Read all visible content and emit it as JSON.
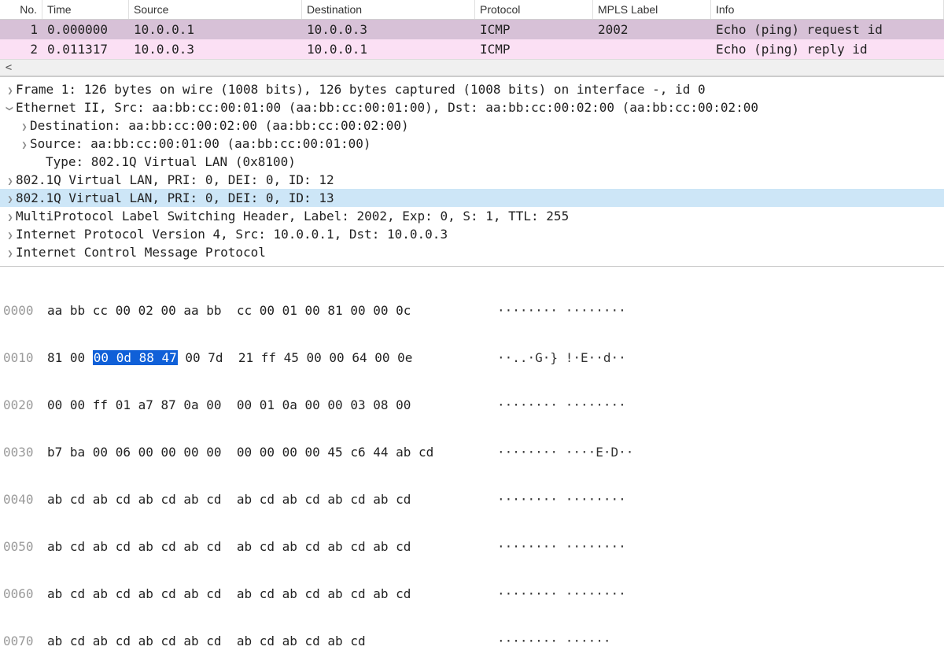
{
  "columns": {
    "no": "No.",
    "time": "Time",
    "source": "Source",
    "destination": "Destination",
    "protocol": "Protocol",
    "mpls": "MPLS Label",
    "info": "Info"
  },
  "packets": [
    {
      "no": "1",
      "time": "0.000000",
      "source": "10.0.0.1",
      "destination": "10.0.0.3",
      "protocol": "ICMP",
      "mpls": "2002",
      "info": "Echo (ping) request  id"
    },
    {
      "no": "2",
      "time": "0.011317",
      "source": "10.0.0.3",
      "destination": "10.0.0.1",
      "protocol": "ICMP",
      "mpls": "",
      "info": "Echo (ping) reply    id"
    }
  ],
  "scroll": {
    "left_arrow": "<"
  },
  "tree": {
    "frame": "Frame 1: 126 bytes on wire (1008 bits), 126 bytes captured (1008 bits) on interface -, id 0",
    "eth": "Ethernet II, Src: aa:bb:cc:00:01:00 (aa:bb:cc:00:01:00), Dst: aa:bb:cc:00:02:00 (aa:bb:cc:00:02:00",
    "eth_dst": "Destination: aa:bb:cc:00:02:00 (aa:bb:cc:00:02:00)",
    "eth_src": "Source: aa:bb:cc:00:01:00 (aa:bb:cc:00:01:00)",
    "eth_type": "Type: 802.1Q Virtual LAN (0x8100)",
    "vlan12": "802.1Q Virtual LAN, PRI: 0, DEI: 0, ID: 12",
    "vlan13": "802.1Q Virtual LAN, PRI: 0, DEI: 0, ID: 13",
    "mpls": "MultiProtocol Label Switching Header, Label: 2002, Exp: 0, S: 1, TTL: 255",
    "ip": "Internet Protocol Version 4, Src: 10.0.0.1, Dst: 10.0.0.3",
    "icmp": "Internet Control Message Protocol"
  },
  "hex": [
    {
      "off": "0000",
      "b1": "aa bb cc 00 02 00 aa bb  ",
      "hl": "",
      "b2": "cc 00 01 00 81 00 00 0c",
      "asc": "········ ········"
    },
    {
      "off": "0010",
      "b1": "81 00 ",
      "hl": "00 0d 88 47",
      "b2": " 00 7d  21 ff 45 00 00 64 00 0e",
      "asc": "··..·G·} !·E··d··"
    },
    {
      "off": "0020",
      "b1": "00 00 ff 01 a7 87 0a 00  ",
      "hl": "",
      "b2": "00 01 0a 00 00 03 08 00",
      "asc": "········ ········"
    },
    {
      "off": "0030",
      "b1": "b7 ba 00 06 00 00 00 00  ",
      "hl": "",
      "b2": "00 00 00 00 45 c6 44 ab cd",
      "asc": "········ ····E·D··"
    },
    {
      "off": "0040",
      "b1": "ab cd ab cd ab cd ab cd  ",
      "hl": "",
      "b2": "ab cd ab cd ab cd ab cd",
      "asc": "········ ········"
    },
    {
      "off": "0050",
      "b1": "ab cd ab cd ab cd ab cd  ",
      "hl": "",
      "b2": "ab cd ab cd ab cd ab cd",
      "asc": "········ ········"
    },
    {
      "off": "0060",
      "b1": "ab cd ab cd ab cd ab cd  ",
      "hl": "",
      "b2": "ab cd ab cd ab cd ab cd",
      "asc": "········ ········"
    },
    {
      "off": "0070",
      "b1": "ab cd ab cd ab cd ab cd  ",
      "hl": "",
      "b2": "ab cd ab cd ab cd",
      "asc": "········ ······"
    }
  ]
}
